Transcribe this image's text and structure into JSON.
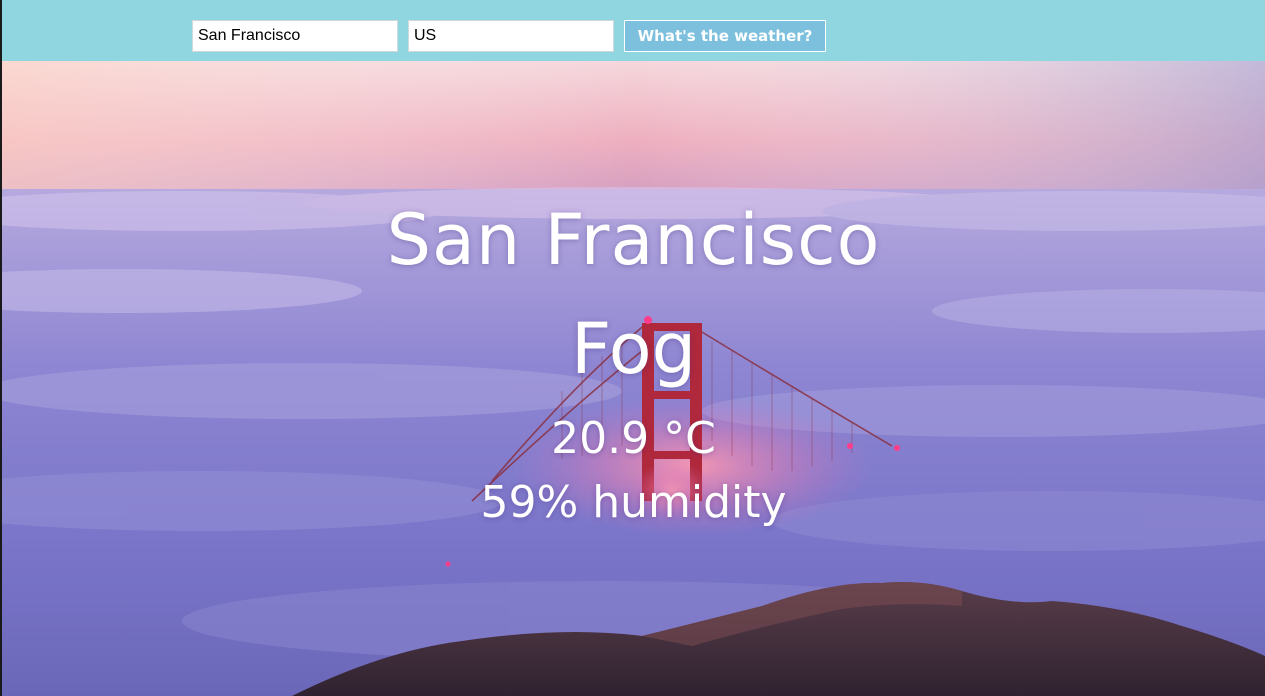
{
  "search": {
    "city_value": "San Francisco",
    "country_value": "US",
    "submit_label": "What's the weather?"
  },
  "weather": {
    "city": "San Francisco",
    "condition": "Fog",
    "temperature": "20.9 °C",
    "humidity": "59% humidity"
  },
  "colors": {
    "topbar": "#8fd6e0",
    "button": "#7cc0dd",
    "text": "#ffffff"
  },
  "icons": {
    "background": "golden-gate-fog-photo"
  }
}
